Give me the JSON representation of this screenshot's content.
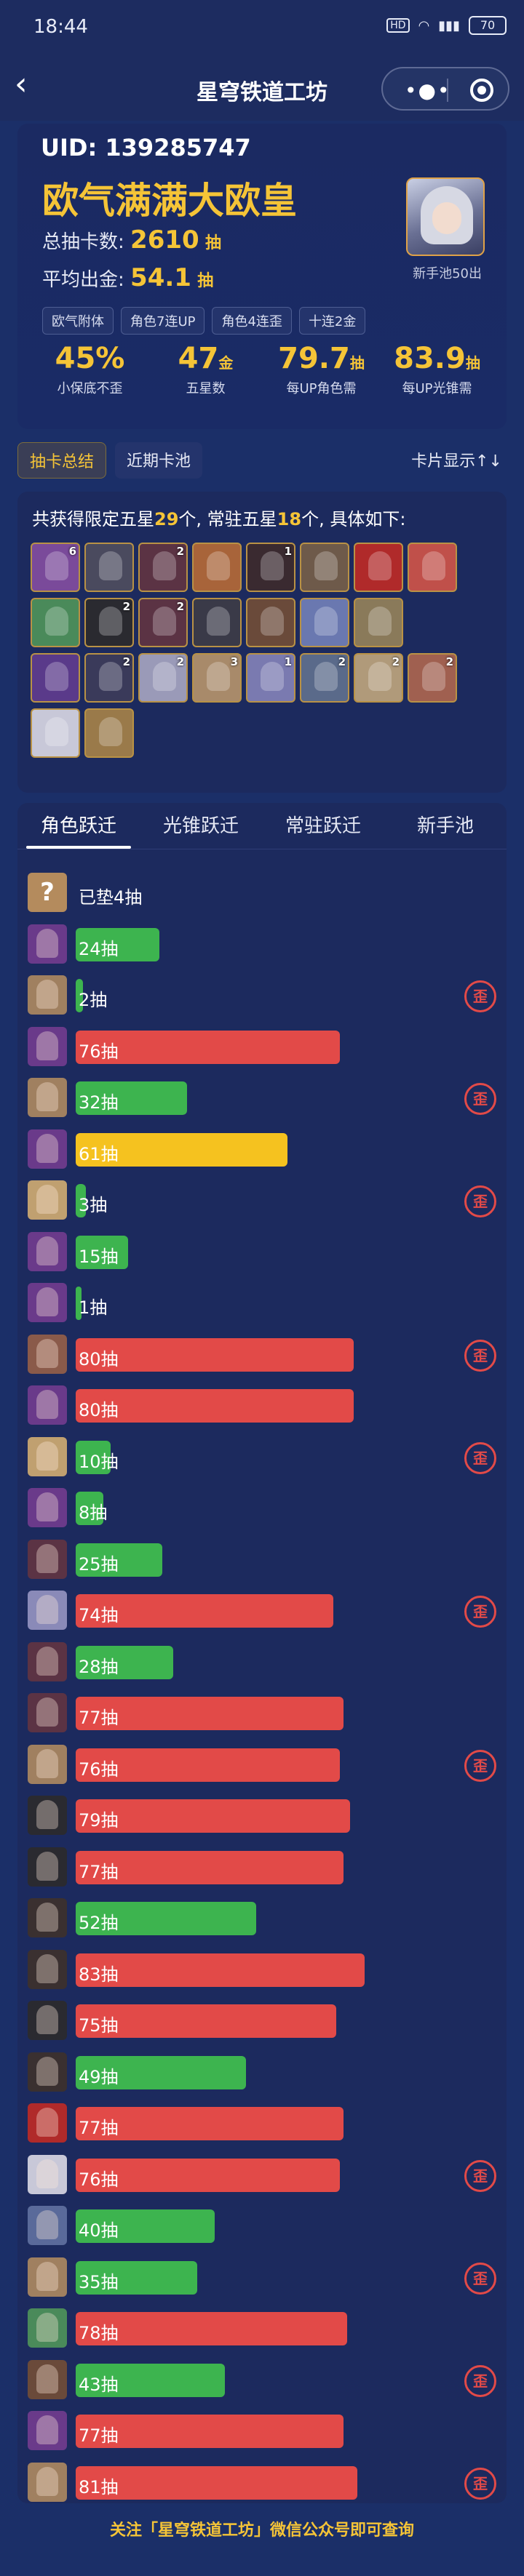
{
  "status_bar": {
    "time": "18:44",
    "hd": "HD",
    "signal": "",
    "battery": "70"
  },
  "nav": {
    "title": "星穹铁道工坊",
    "more_icon": "more-dots-icon",
    "close_icon": "target-icon"
  },
  "profile": {
    "uid_label": "UID:",
    "uid": "139285747",
    "nickname": "欧气满满大欧皇",
    "total_pulls_label": "总抽卡数:",
    "total_pulls": "2610",
    "total_pulls_unit": "抽",
    "avg_label": "平均出金:",
    "avg": "54.1",
    "avg_unit": "抽",
    "avatar_caption": "新手池50出",
    "tags": [
      "欧气附体",
      "角色7连UP",
      "角色4连歪",
      "十连2金"
    ]
  },
  "metrics": [
    {
      "num": "45%",
      "unit": "",
      "label": "小保底不歪"
    },
    {
      "num": "47",
      "unit": "金",
      "label": "五星数"
    },
    {
      "num": "79.7",
      "unit": "抽",
      "label": "每UP角色需"
    },
    {
      "num": "83.9",
      "unit": "抽",
      "label": "每UP光锥需"
    }
  ],
  "subtabs": [
    "抽卡总结",
    "近期卡池"
  ],
  "card_display": "卡片显示↑↓",
  "summary": {
    "prefix": "共获得限定五星",
    "limited": "29",
    "mid": "个, 常驻五星",
    "standard": "18",
    "suffix": "个, 具体如下:"
  },
  "icon_rows": [
    [
      {
        "c": "#7a4a9a",
        "n": "6"
      },
      {
        "c": "#4a4a5e",
        "n": ""
      },
      {
        "c": "#5b3344",
        "n": "2"
      },
      {
        "c": "#a8643a",
        "n": ""
      },
      {
        "c": "#3a2a30",
        "n": "1"
      },
      {
        "c": "#6e5a4a",
        "n": ""
      },
      {
        "c": "#b02a2a",
        "n": ""
      },
      {
        "c": "#c0504a",
        "n": ""
      }
    ],
    [
      {
        "c": "#4a8a5a",
        "n": ""
      },
      {
        "c": "#2a2a30",
        "n": "2"
      },
      {
        "c": "#5b3344",
        "n": "2"
      },
      {
        "c": "#3a3a48",
        "n": ""
      },
      {
        "c": "#6a4a3a",
        "n": ""
      },
      {
        "c": "#6a78b0",
        "n": ""
      },
      {
        "c": "#8a7a5a",
        "n": ""
      }
    ],
    [
      {
        "c": "#5a3a8a",
        "n": ""
      },
      {
        "c": "#3a3a5a",
        "n": "2"
      },
      {
        "c": "#9a9ab8",
        "n": "2"
      },
      {
        "c": "#a88a6a",
        "n": "3"
      },
      {
        "c": "#7a7ab0",
        "n": "1"
      },
      {
        "c": "#5a6a8a",
        "n": "2"
      },
      {
        "c": "#b09a7a",
        "n": "2"
      },
      {
        "c": "#a06050",
        "n": "2"
      }
    ],
    [
      {
        "c": "#c8c8d8",
        "n": ""
      },
      {
        "c": "#9a7a4a",
        "n": ""
      }
    ]
  ],
  "tabs": [
    "角色跃迁",
    "光锥跃迁",
    "常驻跃迁",
    "新手池"
  ],
  "pull_rows": [
    {
      "label": "已垫4抽",
      "pulls": 4,
      "color": "empty",
      "wai": false,
      "avatar": "#b48b5d",
      "unknown": true
    },
    {
      "label": "24抽",
      "pulls": 24,
      "color": "green",
      "wai": false,
      "avatar": "#6a3a8a"
    },
    {
      "label": "2抽",
      "pulls": 2,
      "color": "green",
      "wai": true,
      "avatar": "#a08060"
    },
    {
      "label": "76抽",
      "pulls": 76,
      "color": "red",
      "wai": false,
      "avatar": "#6a3a8a"
    },
    {
      "label": "32抽",
      "pulls": 32,
      "color": "green",
      "wai": true,
      "avatar": "#a08060"
    },
    {
      "label": "61抽",
      "pulls": 61,
      "color": "gold",
      "wai": false,
      "avatar": "#6a3a8a"
    },
    {
      "label": "3抽",
      "pulls": 3,
      "color": "green",
      "wai": true,
      "avatar": "#c0a070"
    },
    {
      "label": "15抽",
      "pulls": 15,
      "color": "green",
      "wai": false,
      "avatar": "#6a3a8a"
    },
    {
      "label": "1抽",
      "pulls": 1,
      "color": "green",
      "wai": false,
      "avatar": "#6a3a8a"
    },
    {
      "label": "80抽",
      "pulls": 80,
      "color": "red",
      "wai": true,
      "avatar": "#8a5a4a"
    },
    {
      "label": "80抽",
      "pulls": 80,
      "color": "red",
      "wai": false,
      "avatar": "#6a3a8a"
    },
    {
      "label": "10抽",
      "pulls": 10,
      "color": "green",
      "wai": true,
      "avatar": "#c0a070"
    },
    {
      "label": "8抽",
      "pulls": 8,
      "color": "green",
      "wai": false,
      "avatar": "#6a3a8a"
    },
    {
      "label": "25抽",
      "pulls": 25,
      "color": "green",
      "wai": false,
      "avatar": "#5b3344"
    },
    {
      "label": "74抽",
      "pulls": 74,
      "color": "red",
      "wai": true,
      "avatar": "#8a8ab8"
    },
    {
      "label": "28抽",
      "pulls": 28,
      "color": "green",
      "wai": false,
      "avatar": "#5b3344"
    },
    {
      "label": "77抽",
      "pulls": 77,
      "color": "red",
      "wai": false,
      "avatar": "#5b3344"
    },
    {
      "label": "76抽",
      "pulls": 76,
      "color": "red",
      "wai": true,
      "avatar": "#a08060"
    },
    {
      "label": "79抽",
      "pulls": 79,
      "color": "red",
      "wai": false,
      "avatar": "#2a2a30"
    },
    {
      "label": "77抽",
      "pulls": 77,
      "color": "red",
      "wai": false,
      "avatar": "#2a2a30"
    },
    {
      "label": "52抽",
      "pulls": 52,
      "color": "green",
      "wai": false,
      "avatar": "#3a3030"
    },
    {
      "label": "83抽",
      "pulls": 83,
      "color": "red",
      "wai": false,
      "avatar": "#3a3030"
    },
    {
      "label": "75抽",
      "pulls": 75,
      "color": "red",
      "wai": false,
      "avatar": "#2a2a30"
    },
    {
      "label": "49抽",
      "pulls": 49,
      "color": "green",
      "wai": false,
      "avatar": "#3a3030"
    },
    {
      "label": "77抽",
      "pulls": 77,
      "color": "red",
      "wai": false,
      "avatar": "#b02a2a"
    },
    {
      "label": "76抽",
      "pulls": 76,
      "color": "red",
      "wai": true,
      "avatar": "#c8c8d8"
    },
    {
      "label": "40抽",
      "pulls": 40,
      "color": "green",
      "wai": false,
      "avatar": "#5a6a9a"
    },
    {
      "label": "35抽",
      "pulls": 35,
      "color": "green",
      "wai": true,
      "avatar": "#a08060"
    },
    {
      "label": "78抽",
      "pulls": 78,
      "color": "red",
      "wai": false,
      "avatar": "#4a8a5a"
    },
    {
      "label": "43抽",
      "pulls": 43,
      "color": "green",
      "wai": true,
      "avatar": "#6a4a3a"
    },
    {
      "label": "77抽",
      "pulls": 77,
      "color": "red",
      "wai": false,
      "avatar": "#6a3a8a"
    },
    {
      "label": "81抽",
      "pulls": 81,
      "color": "red",
      "wai": true,
      "avatar": "#a08060"
    }
  ],
  "wai_badge": "歪",
  "footer": "关注「星穹铁道工坊」微信公众号即可查询",
  "colors": {
    "accent": "#f5c437",
    "green": "#3db44f",
    "red": "#e24a48",
    "gold": "#f5c21f",
    "bg": "#1b2f68"
  }
}
